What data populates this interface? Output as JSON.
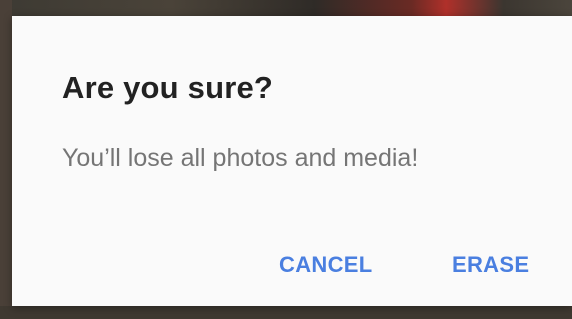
{
  "dialog": {
    "title": "Are you sure?",
    "message": "You’ll lose all photos and media!",
    "actions": {
      "cancel_label": "CANCEL",
      "erase_label": "ERASE"
    }
  },
  "colors": {
    "accent": "#4a7fe0",
    "title_text": "#222222",
    "message_text": "#757575",
    "dialog_background": "#fafafa"
  }
}
